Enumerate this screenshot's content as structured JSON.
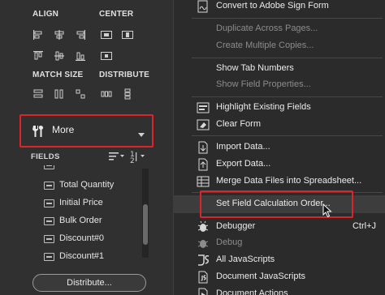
{
  "left_panel": {
    "align_title": "ALIGN",
    "center_title": "CENTER",
    "match_size_title": "MATCH SIZE",
    "distribute_title": "DISTRIBUTE",
    "more_label": "More",
    "fields_label": "FIELDS",
    "fields": [
      "Total Quantity",
      "Initial Price",
      "Bulk Order",
      "Discount#0",
      "Discount#1"
    ],
    "distribute_button": "Distribute..."
  },
  "menu": {
    "items": [
      {
        "label": "Convert to Adobe Sign Form",
        "icon": "sign-form-icon",
        "enabled": true
      },
      {
        "label": "Duplicate Across Pages...",
        "enabled": false
      },
      {
        "label": "Create Multiple Copies...",
        "enabled": false
      },
      {
        "label": "Show Tab Numbers",
        "enabled": true
      },
      {
        "label": "Show Field Properties...",
        "enabled": false
      },
      {
        "label": "Highlight Existing Fields",
        "icon": "highlight-fields-icon",
        "enabled": true
      },
      {
        "label": "Clear Form",
        "icon": "clear-form-icon",
        "enabled": true
      },
      {
        "label": "Import Data...",
        "icon": "import-data-icon",
        "enabled": true
      },
      {
        "label": "Export Data...",
        "icon": "export-data-icon",
        "enabled": true
      },
      {
        "label": "Merge Data Files into Spreadsheet...",
        "icon": "merge-data-icon",
        "enabled": true
      },
      {
        "label": "Set Field Calculation Order...",
        "enabled": true,
        "hovered": true
      },
      {
        "label": "Debugger",
        "icon": "debugger-icon",
        "shortcut": "Ctrl+J",
        "enabled": true
      },
      {
        "label": "Debug",
        "icon": "debug-icon",
        "enabled": false
      },
      {
        "label": "All JavaScripts",
        "icon": "javascript-icon",
        "enabled": true
      },
      {
        "label": "Document JavaScripts",
        "icon": "document-javascript-icon",
        "enabled": true
      },
      {
        "label": "Document Actions",
        "icon": "document-actions-icon",
        "enabled": true
      }
    ]
  },
  "colors": {
    "highlight_red": "#e0232b",
    "panel_bg": "#303030",
    "menu_bg": "#2b2b2b"
  }
}
